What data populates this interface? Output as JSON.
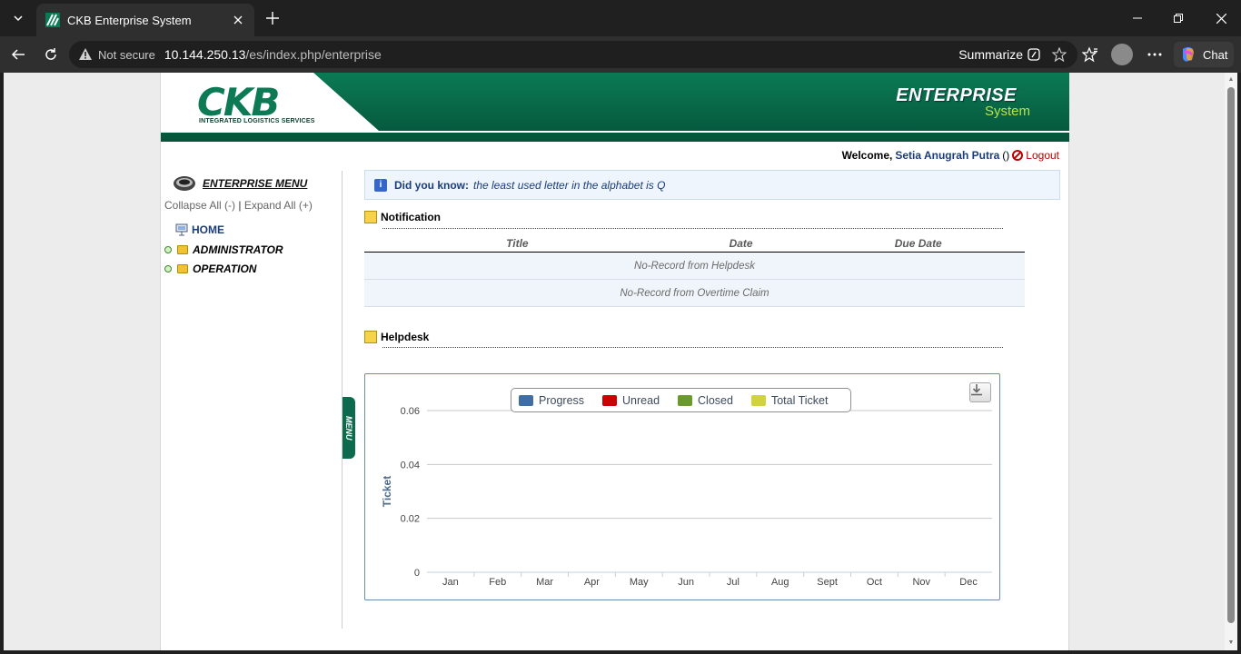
{
  "browser": {
    "tab_title": "CKB Enterprise System",
    "not_secure": "Not secure",
    "url_host": "10.144.250.13",
    "url_path": "/es/index.php/enterprise",
    "summarize": "Summarize",
    "chat": "Chat"
  },
  "header": {
    "logo": "CKB",
    "logo_subtitle": "INTEGRATED LOGISTICS SERVICES",
    "app_title": "ENTERPRISE",
    "app_subtitle": "System"
  },
  "welcome": {
    "prefix": "Welcome,",
    "user": "Setia Anugrah Putra",
    "paren": "()",
    "logout": "Logout"
  },
  "sidebar": {
    "title": "ENTERPRISE MENU",
    "collapse": "Collapse All (-)",
    "separator": "|",
    "expand": "Expand All (+)",
    "items": [
      {
        "label": "HOME"
      },
      {
        "label": "ADMINISTRATOR"
      },
      {
        "label": "OPERATION"
      }
    ],
    "menu_tab": "MENU"
  },
  "tip": {
    "label": "Did you know:",
    "text": "the least used letter in the alphabet is Q"
  },
  "notification": {
    "title": "Notification",
    "columns": [
      "Title",
      "Date",
      "Due Date"
    ],
    "rows": [
      "No-Record from Helpdesk",
      "No-Record from Overtime Claim"
    ]
  },
  "helpdesk": {
    "title": "Helpdesk"
  },
  "chart_data": {
    "type": "bar",
    "title": "",
    "xlabel": "",
    "ylabel": "Ticket",
    "categories": [
      "Jan",
      "Feb",
      "Mar",
      "Apr",
      "May",
      "Jun",
      "Jul",
      "Aug",
      "Sept",
      "Oct",
      "Nov",
      "Dec"
    ],
    "series": [
      {
        "name": "Progress",
        "color": "#3d6ea5",
        "values": [
          0,
          0,
          0,
          0,
          0,
          0,
          0,
          0,
          0,
          0,
          0,
          0
        ]
      },
      {
        "name": "Unread",
        "color": "#cc0000",
        "values": [
          0,
          0,
          0,
          0,
          0,
          0,
          0,
          0,
          0,
          0,
          0,
          0
        ]
      },
      {
        "name": "Closed",
        "color": "#6a9a2e",
        "values": [
          0,
          0,
          0,
          0,
          0,
          0,
          0,
          0,
          0,
          0,
          0,
          0
        ]
      },
      {
        "name": "Total Ticket",
        "color": "#d1d33a",
        "values": [
          0,
          0,
          0,
          0,
          0,
          0,
          0,
          0,
          0,
          0,
          0,
          0
        ]
      }
    ],
    "yticks": [
      "0",
      "0.02",
      "0.04",
      "0.06"
    ],
    "ylim": [
      0,
      0.06
    ],
    "grid": true,
    "legend_position": "top"
  }
}
